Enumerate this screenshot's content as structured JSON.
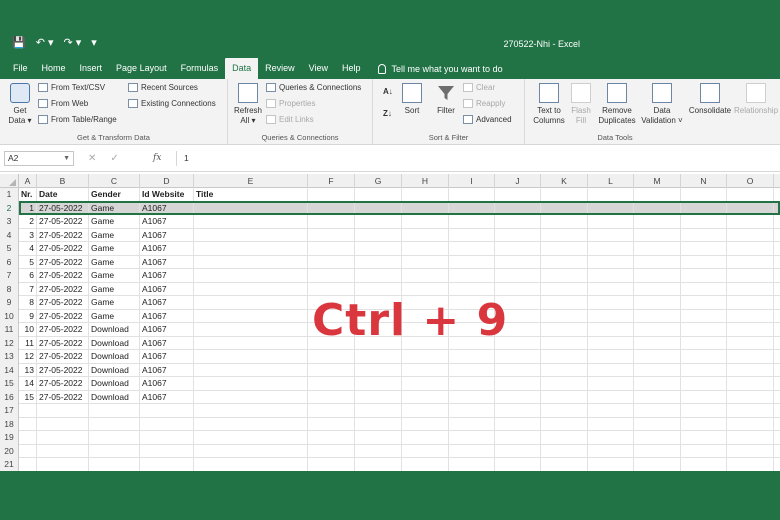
{
  "window": {
    "title": "270522-Nhi  -  Excel",
    "qat": {
      "save_icon": "save-icon",
      "undo_icon": "undo-icon",
      "redo_icon": "redo-icon"
    }
  },
  "tabs": [
    "File",
    "Home",
    "Insert",
    "Page Layout",
    "Formulas",
    "Data",
    "Review",
    "View",
    "Help"
  ],
  "active_tab": "Data",
  "tell_me": "Tell me what you want to do",
  "ribbon": {
    "get_transform": {
      "label": "Get & Transform Data",
      "get_data": [
        "Get",
        "Data ▾"
      ],
      "from_text_csv": "From Text/CSV",
      "from_web": "From Web",
      "from_table": "From Table/Range",
      "recent_sources": "Recent Sources",
      "existing_connections": "Existing Connections"
    },
    "queries": {
      "label": "Queries & Connections",
      "refresh_all": [
        "Refresh",
        "All ▾"
      ],
      "queries_connections": "Queries & Connections",
      "properties": "Properties",
      "edit_links": "Edit Links"
    },
    "sort_filter": {
      "label": "Sort & Filter",
      "sort": "Sort",
      "filter": "Filter",
      "clear": "Clear",
      "reapply": "Reapply",
      "advanced": "Advanced"
    },
    "data_tools": {
      "label": "Data Tools",
      "text_to_columns": [
        "Text to",
        "Columns"
      ],
      "flash_fill": [
        "Flash",
        "Fill"
      ],
      "remove_duplicates": [
        "Remove",
        "Duplicates"
      ],
      "data_validation": [
        "Data",
        "Validation ˅"
      ],
      "consolidate": "Consolidate",
      "relationships": "Relationships"
    }
  },
  "formula_bar": {
    "name_box": "A2",
    "cancel": "✕",
    "enter": "✓",
    "fx": "fx",
    "value": "1"
  },
  "columns": [
    "A",
    "B",
    "C",
    "D",
    "E",
    "F",
    "G",
    "H",
    "I",
    "J",
    "K",
    "L",
    "M",
    "N",
    "O"
  ],
  "table": {
    "headers": [
      "Nr.",
      "Date",
      "Gender",
      "Id Website",
      "Title"
    ],
    "rows": [
      [
        "1",
        "27-05-2022",
        "Game",
        "A1067"
      ],
      [
        "2",
        "27-05-2022",
        "Game",
        "A1067"
      ],
      [
        "3",
        "27-05-2022",
        "Game",
        "A1067"
      ],
      [
        "4",
        "27-05-2022",
        "Game",
        "A1067"
      ],
      [
        "5",
        "27-05-2022",
        "Game",
        "A1067"
      ],
      [
        "6",
        "27-05-2022",
        "Game",
        "A1067"
      ],
      [
        "7",
        "27-05-2022",
        "Game",
        "A1067"
      ],
      [
        "8",
        "27-05-2022",
        "Game",
        "A1067"
      ],
      [
        "9",
        "27-05-2022",
        "Game",
        "A1067"
      ],
      [
        "10",
        "27-05-2022",
        "Download",
        "A1067"
      ],
      [
        "11",
        "27-05-2022",
        "Download",
        "A1067"
      ],
      [
        "12",
        "27-05-2022",
        "Download",
        "A1067"
      ],
      [
        "13",
        "27-05-2022",
        "Download",
        "A1067"
      ],
      [
        "14",
        "27-05-2022",
        "Download",
        "A1067"
      ],
      [
        "15",
        "27-05-2022",
        "Download",
        "A1067"
      ]
    ]
  },
  "row_numbers": [
    "1",
    "2",
    "3",
    "4",
    "5",
    "6",
    "7",
    "8",
    "9",
    "10",
    "11",
    "12",
    "13",
    "14",
    "15",
    "16",
    "17",
    "18",
    "19",
    "20",
    "21"
  ],
  "selected_row": "2",
  "overlay_text": "Ctrl + 9",
  "colors": {
    "excel_green": "#217346",
    "overlay_red": "#d9363e",
    "selected_row": "#d6d6d6"
  }
}
